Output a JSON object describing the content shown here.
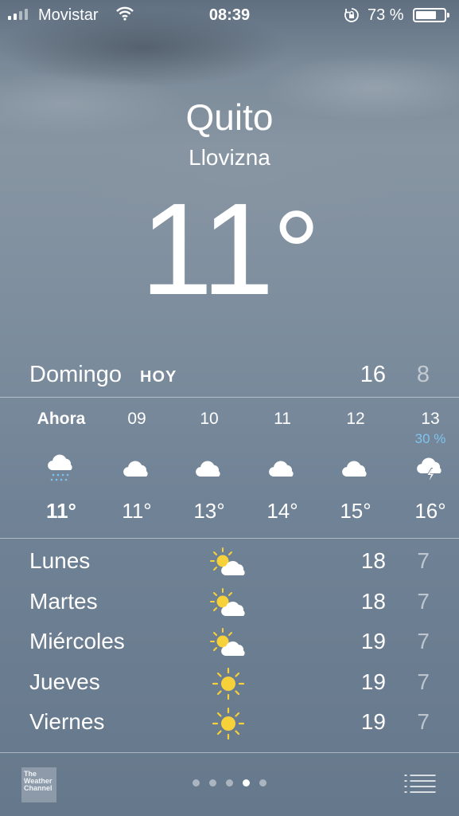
{
  "status_bar": {
    "carrier": "Movistar",
    "time": "08:39",
    "battery_percent": "73 %",
    "battery_level": 0.73,
    "signal_icon": "signal-bars-icon",
    "wifi_icon": "wifi-icon",
    "rotation_lock_icon": "rotation-lock-icon"
  },
  "location": {
    "city": "Quito",
    "condition": "Llovizna",
    "temperature": "11",
    "degree_symbol": "°"
  },
  "today": {
    "day": "Domingo",
    "label": "HOY",
    "high": "16",
    "low": "8"
  },
  "hourly": [
    {
      "time": "Ahora",
      "temp": "11°",
      "icon": "drizzle-icon",
      "pop": ""
    },
    {
      "time": "09",
      "temp": "11°",
      "icon": "cloud-icon",
      "pop": ""
    },
    {
      "time": "10",
      "temp": "13°",
      "icon": "cloud-icon",
      "pop": ""
    },
    {
      "time": "11",
      "temp": "14°",
      "icon": "cloud-icon",
      "pop": ""
    },
    {
      "time": "12",
      "temp": "15°",
      "icon": "cloud-icon",
      "pop": ""
    },
    {
      "time": "13",
      "temp": "16°",
      "icon": "thunderstorm-icon",
      "pop": "30 %"
    }
  ],
  "daily": [
    {
      "day": "Lunes",
      "icon": "partly-sunny-icon",
      "high": "18",
      "low": "7"
    },
    {
      "day": "Martes",
      "icon": "partly-sunny-icon",
      "high": "18",
      "low": "7"
    },
    {
      "day": "Miércoles",
      "icon": "partly-sunny-icon",
      "high": "19",
      "low": "7"
    },
    {
      "day": "Jueves",
      "icon": "sun-icon",
      "high": "19",
      "low": "7"
    },
    {
      "day": "Viernes",
      "icon": "sun-icon",
      "high": "19",
      "low": "7"
    }
  ],
  "footer": {
    "logo_lines": [
      "The",
      "Weather",
      "Channel"
    ],
    "page_count": 5,
    "active_page": 4,
    "list_icon": "list-icon"
  },
  "colors": {
    "precipitation_accent": "#7fc3f0",
    "sun_yellow": "#f7d13a"
  }
}
